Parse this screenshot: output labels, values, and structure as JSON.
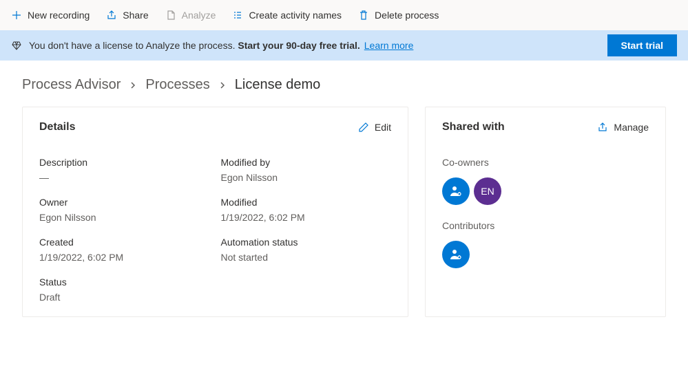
{
  "toolbar": {
    "new_recording": "New recording",
    "share": "Share",
    "analyze": "Analyze",
    "create_activity_names": "Create activity names",
    "delete_process": "Delete process"
  },
  "banner": {
    "message_pre": "You don't have a license to Analyze the process. ",
    "message_bold": "Start your 90-day free trial.",
    "learn_more": "Learn more",
    "start_trial": "Start trial"
  },
  "breadcrumb": {
    "root": "Process Advisor",
    "processes": "Processes",
    "current": "License demo"
  },
  "details": {
    "title": "Details",
    "edit": "Edit",
    "fields": {
      "description_label": "Description",
      "description_value": "—",
      "owner_label": "Owner",
      "owner_value": "Egon Nilsson",
      "created_label": "Created",
      "created_value": "1/19/2022, 6:02 PM",
      "status_label": "Status",
      "status_value": "Draft",
      "modified_by_label": "Modified by",
      "modified_by_value": "Egon Nilsson",
      "modified_label": "Modified",
      "modified_value": "1/19/2022, 6:02 PM",
      "automation_status_label": "Automation status",
      "automation_status_value": "Not started"
    }
  },
  "shared": {
    "title": "Shared with",
    "manage": "Manage",
    "coowners_label": "Co-owners",
    "coowners_initials": "EN",
    "contributors_label": "Contributors"
  }
}
